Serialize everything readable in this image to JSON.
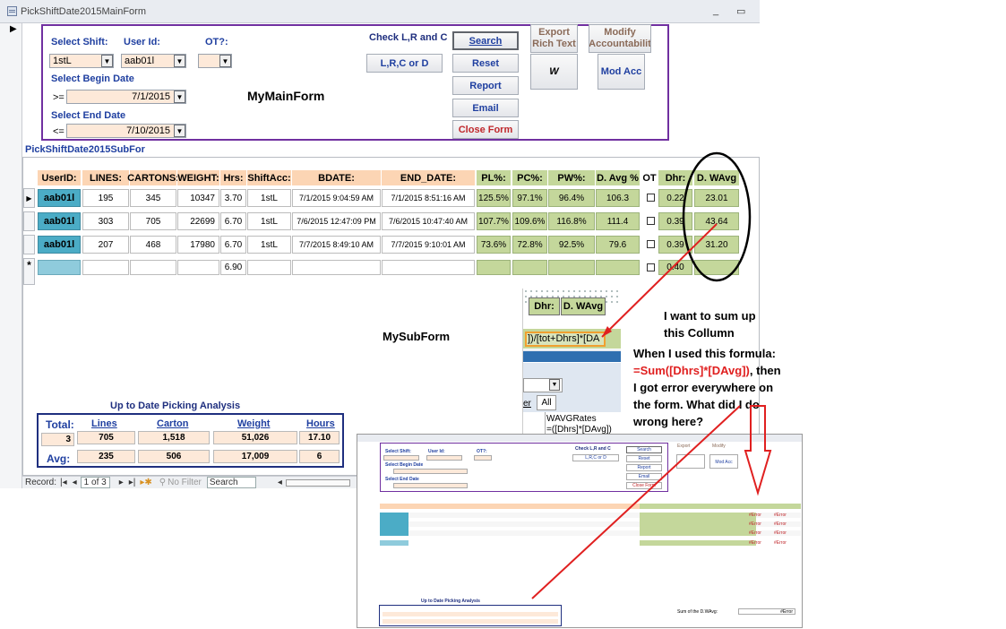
{
  "window": {
    "title": "PickShiftDate2015MainForm",
    "minimize": "_",
    "restore": "▭"
  },
  "main_form": {
    "select_shift_label": "Select Shift:",
    "user_id_label": "User Id:",
    "ot_label": "OT?:",
    "shift_value": "1stL",
    "user_value": "aab01l",
    "ot_value": "",
    "begin_date_label": "Select Begin Date",
    "begin_op": ">=",
    "begin_date": "7/1/2015",
    "end_date_label": "Select End Date",
    "end_op": "<=",
    "end_date": "7/10/2015",
    "form_caption": "MyMainForm",
    "check_label": "Check L,R and C",
    "lrc_button": "L,R,C or D",
    "search_button": "Search",
    "reset_button": "Reset",
    "report_button": "Report",
    "email_button": "Email",
    "close_button": "Close Form",
    "export_label": "Export Rich Text",
    "modify_label": "Modify Accountabilit",
    "word_button": "W",
    "modacc_button": "Mod Acc"
  },
  "subform": {
    "title": "PickShiftDate2015SubFor",
    "caption": "MySubForm",
    "columns": [
      "UserID:",
      "LINES:",
      "CARTONS:",
      "WEIGHT:",
      "Hrs:",
      "ShiftAcc:",
      "BDATE:",
      "END_DATE:",
      "PL%:",
      "PC%:",
      "PW%:",
      "D. Avg %",
      "OT",
      "Dhr:",
      "D. WAvg"
    ],
    "rows": [
      {
        "user": "aab01l",
        "lines": "195",
        "cartons": "345",
        "weight": "10347",
        "hrs": "3.70",
        "shift": "1stL",
        "bdate": "7/1/2015 9:04:59 AM",
        "edate": "7/1/2015 8:51:16 AM",
        "pl": "125.5%",
        "pc": "97.1%",
        "pw": "96.4%",
        "davg": "106.3",
        "dhr": "0.22",
        "dwavg": "23.01"
      },
      {
        "user": "aab01l",
        "lines": "303",
        "cartons": "705",
        "weight": "22699",
        "hrs": "6.70",
        "shift": "1stL",
        "bdate": "7/6/2015 12:47:09 PM",
        "edate": "7/6/2015 10:47:40 AM",
        "pl": "107.7%",
        "pc": "109.6%",
        "pw": "116.8%",
        "davg": "111.4",
        "dhr": "0.39",
        "dwavg": "43.64"
      },
      {
        "user": "aab01l",
        "lines": "207",
        "cartons": "468",
        "weight": "17980",
        "hrs": "6.70",
        "shift": "1stL",
        "bdate": "7/7/2015 8:49:10 AM",
        "edate": "7/7/2015 9:10:01 AM",
        "pl": "73.6%",
        "pc": "72.8%",
        "pw": "92.5%",
        "davg": "79.6",
        "dhr": "0.39",
        "dwavg": "31.20"
      }
    ],
    "new_row": {
      "hrs": "6.90",
      "dhr": "0.40"
    }
  },
  "analysis": {
    "title": "Up to Date Picking Analysis",
    "total_label": "Total:",
    "avg_label": "Avg:",
    "headers": [
      "Lines",
      "Carton",
      "Weight",
      "Hours"
    ],
    "total_count": "3",
    "totals": [
      "705",
      "1,518",
      "51,026",
      "17.10"
    ],
    "avgs": [
      "235",
      "506",
      "17,009",
      "6"
    ]
  },
  "record_nav": {
    "label": "Record:",
    "position": "1 of 3",
    "filter": "No Filter",
    "search": "Search"
  },
  "zoom_inset": {
    "dhr": "Dhr:",
    "dwavg": "D. WAvg",
    "formula": "])/[tot+Dhrs]*[DA",
    "tab": "All",
    "list1": "WAVGRates",
    "list2": "=([Dhrs]*[DAvg])",
    "er": "er"
  },
  "annotations": {
    "note1": "I want to sum up this Collumn",
    "note2_pre": "When I used this formula:",
    "note2_formula": "=Sum([Dhrs]*[DAvg])",
    "note2_post1": ", then",
    "note2_post2": "I got error everywhere on the form. What did I do wrong here?"
  },
  "thumb": {
    "error": "#Error",
    "sum_label": "Sum of the D.WAvg:",
    "select_shift": "Select Shift:",
    "user_id": "User Id:",
    "ot": "OT?:",
    "begin": "Select Begin Date",
    "end": "Select End Date",
    "check": "Check L,R and C",
    "lrc": "L,R,C or D",
    "search": "Search",
    "reset": "Reset",
    "report": "Report",
    "email": "Email",
    "close": "Close Form",
    "export": "Export",
    "modify": "Modify",
    "modacc": "Mod Acc",
    "analysis": "Up to Date Picking Analysis"
  },
  "colors": {
    "peach": "#fcd5b4",
    "green": "#c4d79b",
    "teal": "#4bacc6",
    "purple": "#7030a0",
    "red": "#e02020",
    "navy": "#1f2f7f"
  }
}
